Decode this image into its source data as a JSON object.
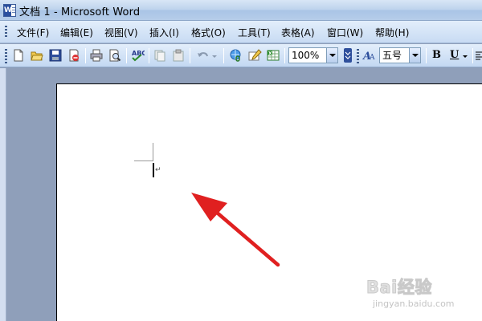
{
  "window": {
    "title": "文档 1 - Microsoft Word"
  },
  "menu": {
    "items": [
      "文件(F)",
      "编辑(E)",
      "视图(V)",
      "插入(I)",
      "格式(O)",
      "工具(T)",
      "表格(A)",
      "窗口(W)",
      "帮助(H)"
    ]
  },
  "toolbar": {
    "buttons": [
      "new-document-icon",
      "open-folder-icon",
      "save-icon",
      "permission-icon",
      "print-icon",
      "print-preview-icon",
      "spelling-check-icon",
      "cut-icon",
      "copy-icon",
      "undo-icon",
      "hyperlink-icon",
      "tables-borders-icon",
      "insert-excel-icon"
    ],
    "zoom": "100%",
    "font_size": "五号",
    "bold_label": "B",
    "underline_label": "U"
  },
  "annotation": {
    "arrow_color": "#e02020"
  },
  "watermark": {
    "main": "Bai经验",
    "sub": "jingyan.baidu.com"
  }
}
